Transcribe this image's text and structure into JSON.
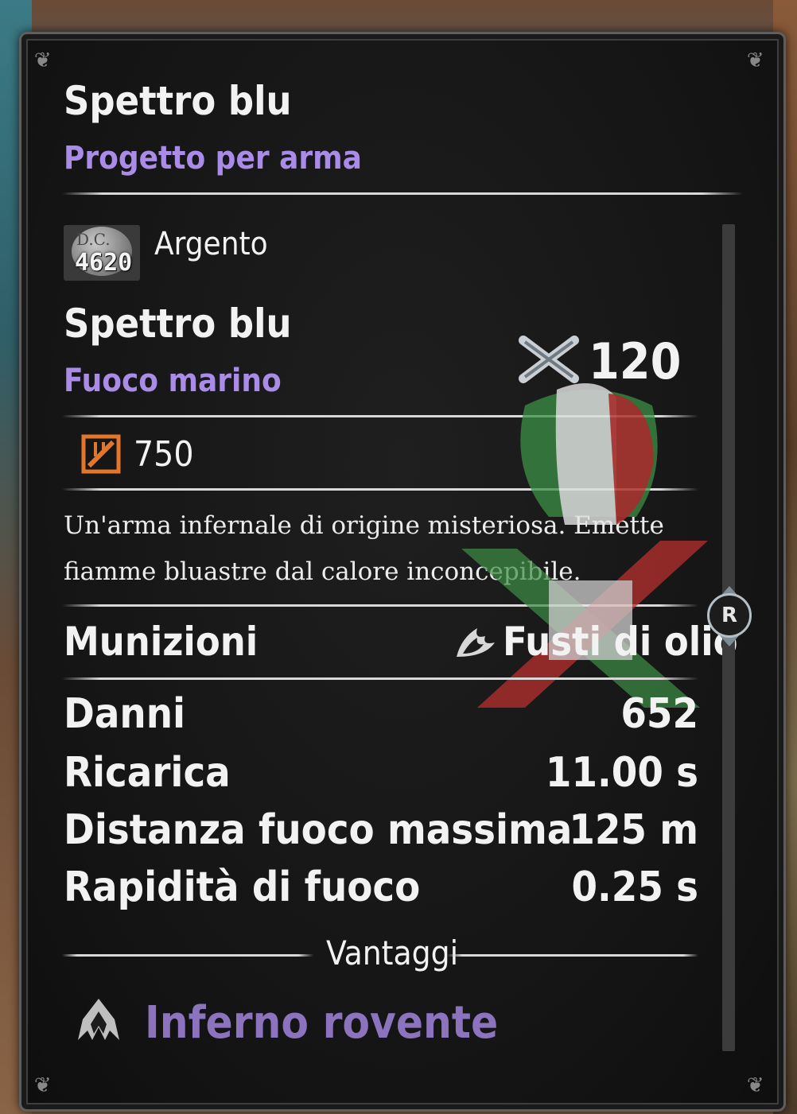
{
  "item": {
    "name": "Spettro blu",
    "type": "Progetto per arma"
  },
  "cost": {
    "coin_icon": "silver-coin-icon",
    "coin_code": "D.C.",
    "amount": "4620",
    "currency": "Argento"
  },
  "weapon": {
    "name": "Spettro blu",
    "subtype": "Fuoco marino",
    "cannon_icon": "crossed-cannons-icon",
    "power": "120",
    "durability_icon": "armor-crate-icon",
    "durability": "750"
  },
  "description": "Un'arma infernale di origine misteriosa. Emette fiamme bluastre dal calore inconcepibile.",
  "ammo": {
    "label": "Munizioni",
    "icon": "flame-icon",
    "value": "Fusti di olio"
  },
  "stats": [
    {
      "label": "Danni",
      "value": "652"
    },
    {
      "label": "Ricarica",
      "value": "11.00 s"
    },
    {
      "label": "Distanza fuoco massima",
      "value": "125 m"
    },
    {
      "label": "Rapidità di fuoco",
      "value": "0.25 s"
    }
  ],
  "perks": {
    "header": "Vantaggi",
    "items": [
      {
        "icon": "inferno-flame-icon",
        "name": "Inferno rovente"
      }
    ]
  },
  "scroll": {
    "button_label": "R"
  },
  "colors": {
    "accent_purple": "#a98ce8",
    "text_light": "#f2f2f2",
    "panel_bg": "#171717",
    "flag_green": "#3d8f46",
    "flag_white": "#e8e8e8",
    "flag_red": "#b9302f"
  }
}
